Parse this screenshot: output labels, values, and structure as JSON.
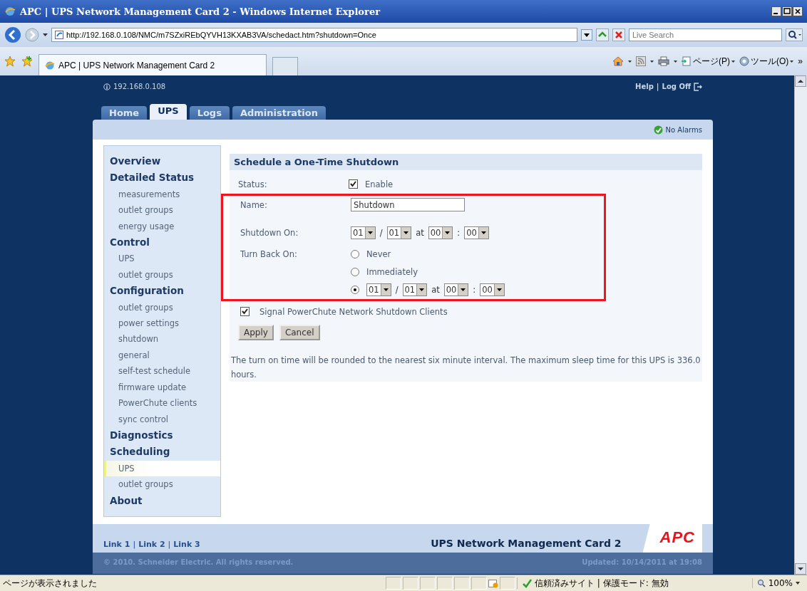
{
  "window": {
    "title": "APC | UPS Network Management Card 2 - Windows Internet Explorer"
  },
  "address_bar": {
    "url": "http://192.168.0.108/NMC/m7SZxiREbQYVH13KXAB3VA/schedact.htm?shutdown=Once",
    "search_placeholder": "Live Search"
  },
  "browser_tab": {
    "label": "APC | UPS Network Management Card 2"
  },
  "toolbar": {
    "items": [
      "ページ(P)",
      "ツール(O)"
    ],
    "overflow": "»"
  },
  "page": {
    "ip": "192.168.0.108",
    "header_links": [
      "Help",
      "Log Off"
    ],
    "separator": "|",
    "tabs": [
      {
        "label": "Home",
        "selected": false
      },
      {
        "label": "UPS",
        "selected": true
      },
      {
        "label": "Logs",
        "selected": false
      },
      {
        "label": "Administration",
        "selected": false
      }
    ],
    "alarm_status": "No Alarms"
  },
  "sidebar": {
    "sections": [
      {
        "label": "Overview",
        "selected": false
      },
      {
        "label": "Detailed Status",
        "selected": false,
        "children": [
          {
            "label": "measurements",
            "selected": false
          },
          {
            "label": "outlet groups",
            "selected": false
          },
          {
            "label": "energy usage",
            "selected": false
          }
        ]
      },
      {
        "label": "Control",
        "selected": false,
        "children": [
          {
            "label": "UPS",
            "selected": false
          },
          {
            "label": "outlet groups",
            "selected": false
          }
        ]
      },
      {
        "label": "Configuration",
        "selected": false,
        "children": [
          {
            "label": "outlet groups",
            "selected": false
          },
          {
            "label": "power settings",
            "selected": false
          },
          {
            "label": "shutdown",
            "selected": false
          },
          {
            "label": "general",
            "selected": false
          },
          {
            "label": "self-test schedule",
            "selected": false
          },
          {
            "label": "firmware update",
            "selected": false
          },
          {
            "label": "PowerChute clients",
            "selected": false
          },
          {
            "label": "sync control",
            "selected": false
          }
        ]
      },
      {
        "label": "Diagnostics",
        "selected": false
      },
      {
        "label": "Scheduling",
        "selected": false,
        "children": [
          {
            "label": "UPS",
            "selected": true
          },
          {
            "label": "outlet groups",
            "selected": false
          }
        ]
      },
      {
        "label": "About",
        "selected": false
      }
    ]
  },
  "form": {
    "title": "Schedule a One-Time Shutdown",
    "highlighted": true,
    "status": {
      "label": "Status:",
      "checkbox_label": "Enable",
      "checked": true
    },
    "name": {
      "label": "Name:",
      "value": "Shutdown"
    },
    "shutdown_on": {
      "label": "Shutdown On:",
      "selects": [
        "01",
        "01",
        "00",
        "00"
      ],
      "separators": [
        "/",
        "at",
        ":"
      ]
    },
    "turn_back_on": {
      "label": "Turn Back On:",
      "options": [
        {
          "kind": "text",
          "label": "Never",
          "selected": false
        },
        {
          "kind": "text",
          "label": "Immediately",
          "selected": false
        },
        {
          "kind": "datetime",
          "selects": [
            "01",
            "01",
            "00",
            "00"
          ],
          "separators": [
            "/",
            "at",
            ":"
          ],
          "selected": true
        }
      ]
    },
    "signal": {
      "label": "Signal PowerChute Network Shutdown Clients",
      "checked": true
    },
    "buttons": [
      "Apply",
      "Cancel"
    ],
    "note": "The turn on time will be rounded to the nearest six minute interval. The maximum sleep time for this UPS is 336.0 hours."
  },
  "footer": {
    "links": [
      "Link 1",
      "Link 2",
      "Link 3"
    ],
    "separator": "|",
    "product": "UPS Network Management Card 2",
    "logo": "APC",
    "copyright": "© 2010. Schneider Electric. All rights reserved.",
    "updated": "Updated: 10/14/2011 at 19:08"
  },
  "status_bar": {
    "message": "ページが表示されました",
    "zone": "信頼済みサイト | 保護モード: 無効",
    "zoom": "100%"
  }
}
